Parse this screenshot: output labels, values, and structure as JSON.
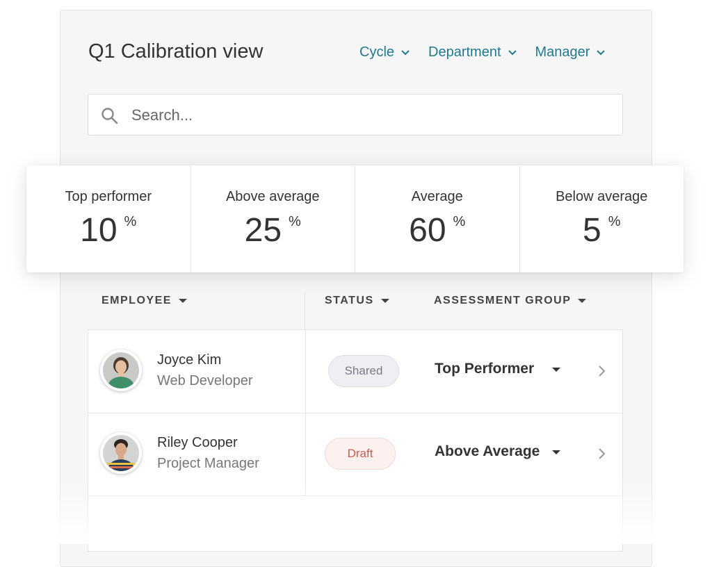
{
  "header": {
    "title": "Q1 Calibration view",
    "filters": [
      {
        "label": "Cycle"
      },
      {
        "label": "Department"
      },
      {
        "label": "Manager"
      }
    ]
  },
  "search": {
    "placeholder": "Search..."
  },
  "stats": [
    {
      "label": "Top performer",
      "value": "10",
      "unit": "%"
    },
    {
      "label": "Above average",
      "value": "25",
      "unit": "%"
    },
    {
      "label": "Average",
      "value": "60",
      "unit": "%"
    },
    {
      "label": "Below average",
      "value": "5",
      "unit": "%"
    }
  ],
  "table": {
    "columns": [
      "EMPLOYEE",
      "STATUS",
      "ASSESSMENT GROUP"
    ],
    "rows": [
      {
        "name": "Joyce Kim",
        "role": "Web Developer",
        "status": "Shared",
        "group": "Top Performer"
      },
      {
        "name": "Riley Cooper",
        "role": "Project Manager",
        "status": "Draft",
        "group": "Above Average"
      }
    ]
  },
  "colors": {
    "accent": "#1f7a8f",
    "draft": "#d05a4c",
    "shared": "#7a7a86"
  },
  "icons": [
    "search-icon",
    "chevron-down-icon",
    "caret-down-icon",
    "chevron-right-icon",
    "avatar"
  ]
}
